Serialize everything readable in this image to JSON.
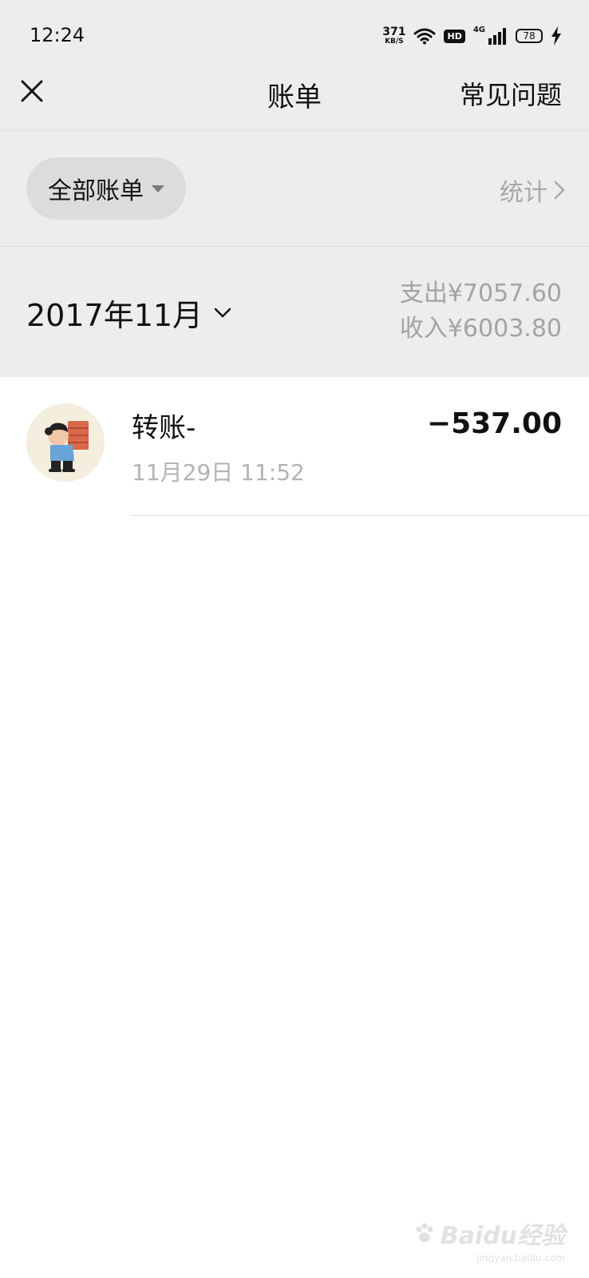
{
  "status_bar": {
    "time": "12:24",
    "net_speed": "371",
    "net_speed_unit": "KB/S",
    "hd": "HD",
    "network_type": "4G",
    "battery": "78",
    "icons": [
      "wifi-icon",
      "signal-icon",
      "charging-icon"
    ]
  },
  "nav": {
    "title": "账单",
    "faq": "常见问题",
    "close_icon": "close-icon"
  },
  "filter": {
    "label": "全部账单",
    "stats": "统计"
  },
  "summary": {
    "month": "2017年11月",
    "expense": "支出¥7057.60",
    "income": "收入¥6003.80"
  },
  "transactions": [
    {
      "title": "转账-",
      "time": "11月29日 11:52",
      "amount": "−537.00"
    }
  ],
  "watermark": {
    "brand": "Baidu经验",
    "url": "jingyan.baidu.com"
  },
  "colors": {
    "header_bg": "#ededed",
    "pill_bg": "#dcdcdc",
    "muted_text": "#a3a3a3",
    "primary_text": "#111111"
  }
}
